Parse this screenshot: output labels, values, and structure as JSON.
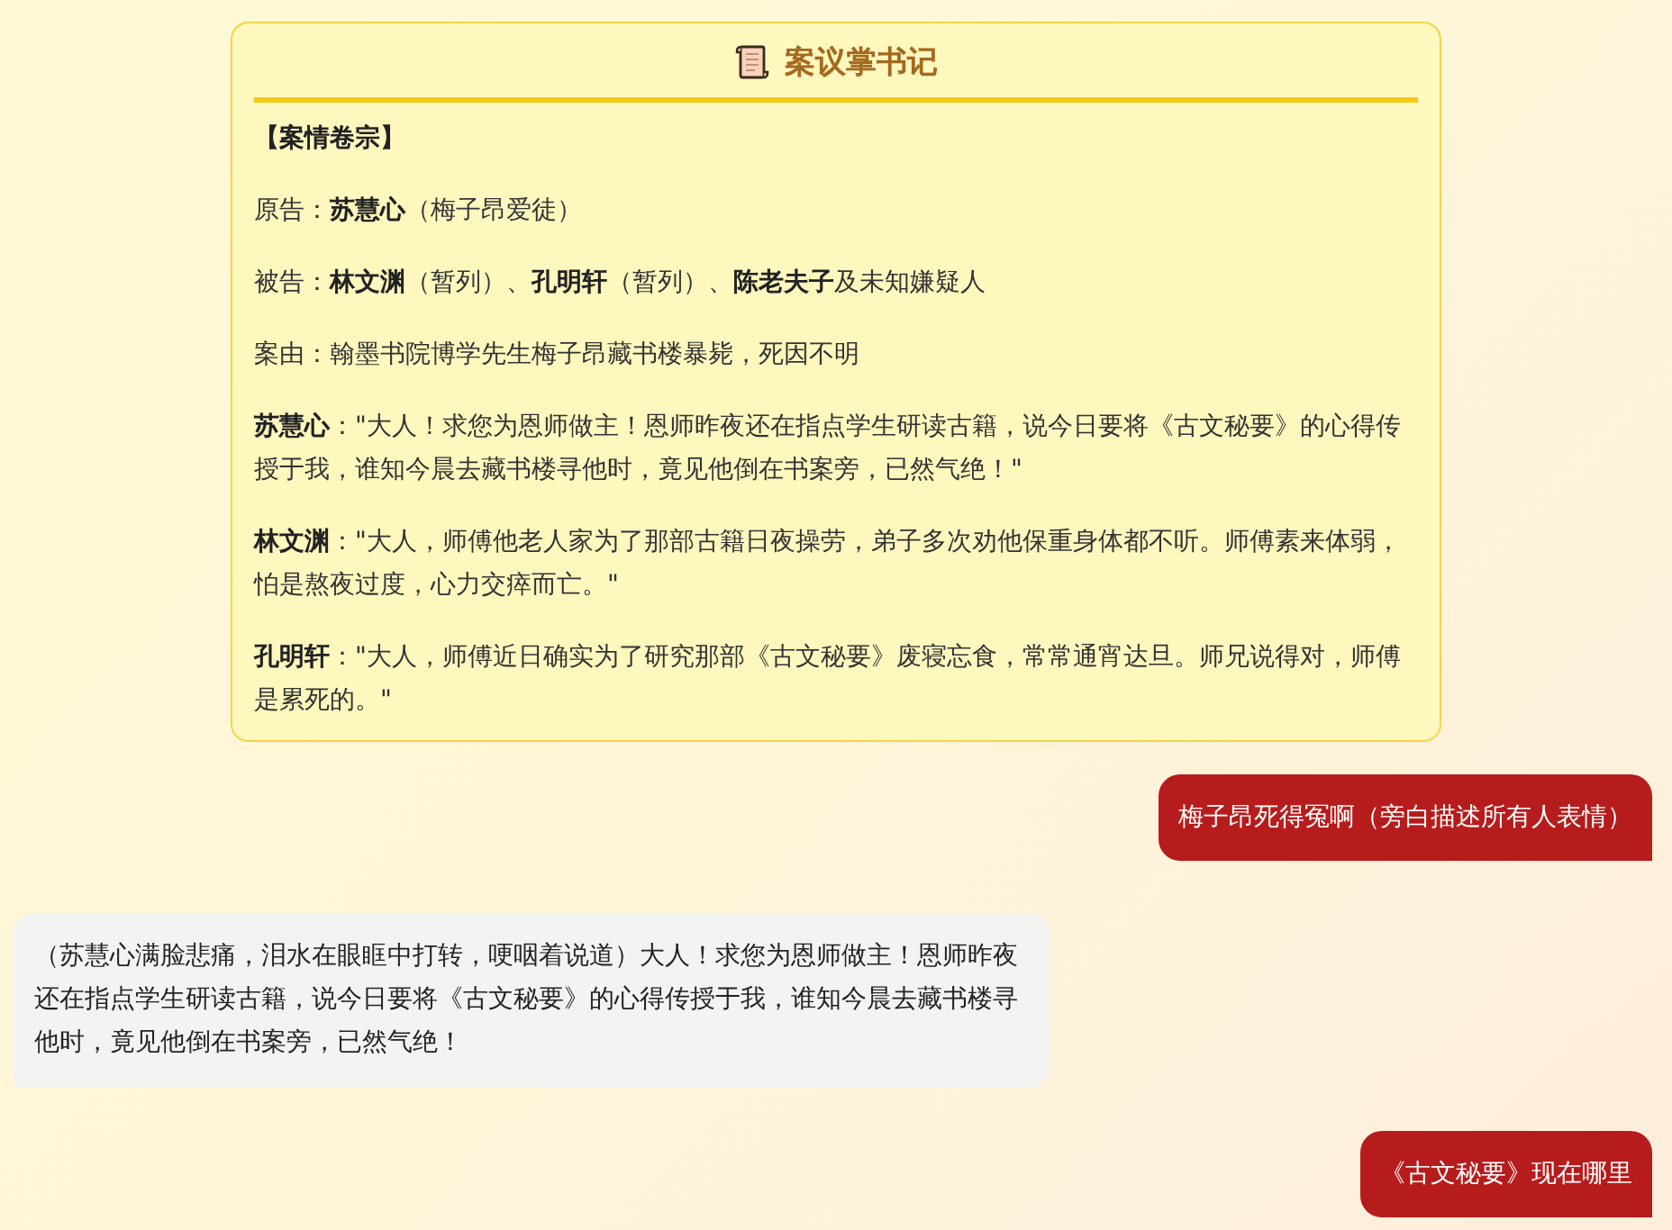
{
  "case_card": {
    "title": "案议掌书记",
    "section_heading": "【案情卷宗】",
    "paragraphs": [
      "原告：**苏慧心**（梅子昂爱徒）",
      "被告：**林文渊**（暂列）、**孔明轩**（暂列）、**陈老夫子**及未知嫌疑人",
      "案由：翰墨书院博学先生梅子昂藏书楼暴毙，死因不明",
      "**苏慧心**：\"大人！求您为恩师做主！恩师昨夜还在指点学生研读古籍，说今日要将《古文秘要》的心得传授于我，谁知今晨去藏书楼寻他时，竟见他倒在书案旁，已然气绝！\"",
      "**林文渊**：\"大人，师傅他老人家为了那部古籍日夜操劳，弟子多次劝他保重身体都不听。师傅素来体弱，怕是熬夜过度，心力交瘁而亡。\"",
      "**孔明轩**：\"大人，师傅近日确实为了研究那部《古文秘要》废寝忘食，常常通宵达旦。师兄说得对，师傅是累死的。\""
    ]
  },
  "messages": [
    {
      "kind": "sent",
      "text": "梅子昂死得冤啊（旁白描述所有人表情）"
    },
    {
      "kind": "received",
      "text": "（苏慧心满脸悲痛，泪水在眼眶中打转，哽咽着说道）大人！求您为恩师做主！恩师昨夜还在指点学生研读古籍，说今日要将《古文秘要》的心得传授于我，谁知今晨去藏书楼寻他时，竟见他倒在书案旁，已然气绝！"
    },
    {
      "kind": "sent",
      "text": "《古文秘要》现在哪里"
    }
  ]
}
